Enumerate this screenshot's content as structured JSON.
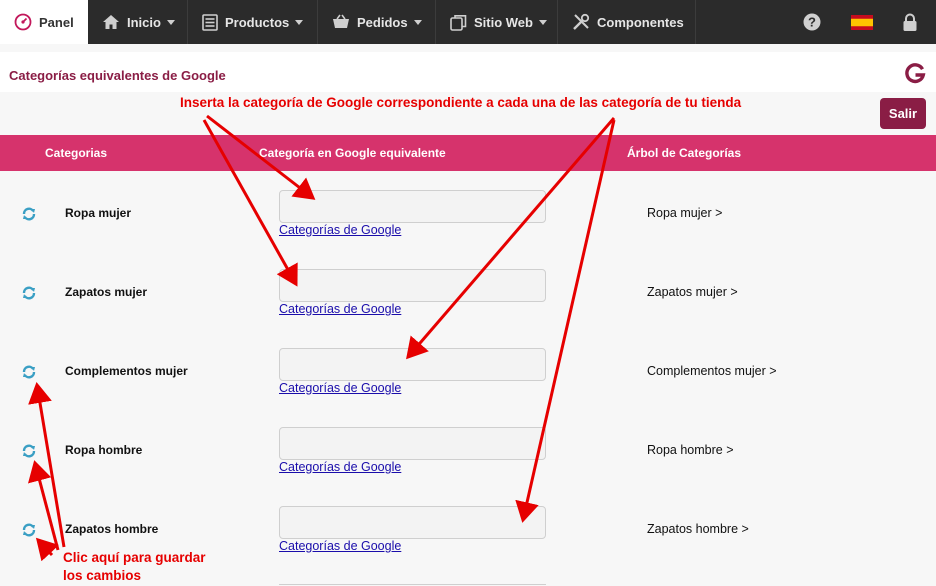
{
  "nav": {
    "panel": "Panel",
    "inicio": "Inicio",
    "productos": "Productos",
    "pedidos": "Pedidos",
    "sitio_web": "Sitio Web",
    "componentes": "Componentes"
  },
  "header": {
    "title": "Categorías equivalentes de Google"
  },
  "toolbar": {
    "exit_label": "Salir"
  },
  "table": {
    "columns": [
      "Categorias",
      "Categoría en Google equivalente",
      "Árbol de Categorías"
    ],
    "link_label": "Categorías de Google",
    "rows": [
      {
        "name": "Ropa mujer",
        "google_value": "",
        "tree": "Ropa mujer >"
      },
      {
        "name": "Zapatos mujer",
        "google_value": "",
        "tree": "Zapatos mujer >"
      },
      {
        "name": "Complementos mujer",
        "google_value": "",
        "tree": "Complementos mujer >"
      },
      {
        "name": "Ropa hombre",
        "google_value": "",
        "tree": "Ropa hombre >"
      },
      {
        "name": "Zapatos hombre",
        "google_value": "",
        "tree": "Zapatos hombre >"
      }
    ]
  },
  "annotations": {
    "top": "Inserta la categoría de Google correspondiente a cada una de las categoría de tu tienda",
    "bottom_line1": "Clic aquí para guardar",
    "bottom_line2": "los cambios"
  },
  "colors": {
    "nav_bg": "#2b2b2b",
    "accent": "#8a1d45",
    "header_pink": "#d6336c",
    "annotation": "#e60000",
    "refresh_icon": "#3a9fc4"
  }
}
